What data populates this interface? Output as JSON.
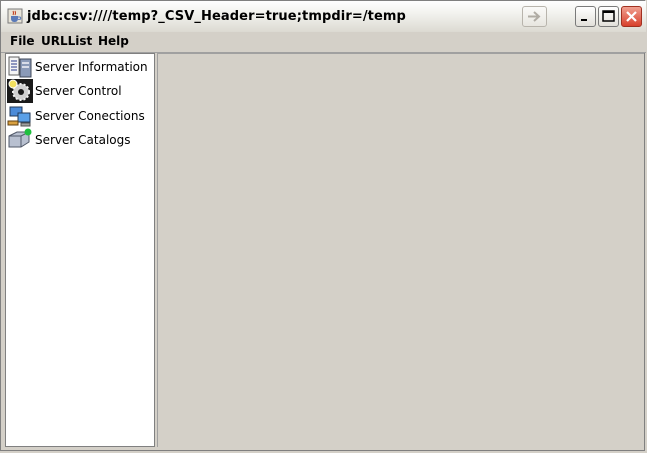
{
  "window": {
    "title": "jdbc:csv:////temp?_CSV_Header=true;tmpdir=/temp",
    "app_icon": "java-cup-icon",
    "controls": [
      "forward-arrow-icon",
      "minimize-icon",
      "maximize-icon",
      "close-icon"
    ]
  },
  "menubar": {
    "items": [
      {
        "label": "File"
      },
      {
        "label": "URLList"
      },
      {
        "label": "Help"
      }
    ]
  },
  "sidebar": {
    "items": [
      {
        "label": "Server Information",
        "icon": "server-info-icon"
      },
      {
        "label": "Server Control",
        "icon": "gear-icon"
      },
      {
        "label": "Server Conections",
        "icon": "network-computers-icon"
      },
      {
        "label": "Server Catalogs",
        "icon": "database-icon"
      }
    ]
  },
  "colors": {
    "window_bg": "#d4d0c8",
    "sidebar_bg": "#ffffff",
    "close_button": "#d8402c"
  }
}
